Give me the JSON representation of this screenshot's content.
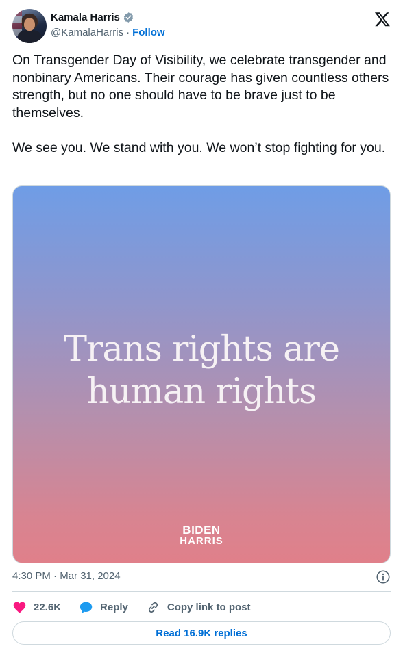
{
  "author": {
    "name": "Kamala Harris",
    "handle": "@KamalaHarris",
    "separator": "·",
    "follow_label": "Follow"
  },
  "tweet": {
    "text": "On Transgender Day of Visibility, we celebrate transgender and nonbinary Americans. Their courage has given countless others strength, but no one should have to be brave just to be themselves.\n\nWe see you. We stand with you. We won’t stop fighting for you.",
    "media": {
      "headline": "Trans rights are\nhuman rights",
      "brand_line1": "BIDEN",
      "brand_line2": "HARRIS"
    },
    "timestamp": "4:30 PM · Mar 31, 2024"
  },
  "actions": {
    "likes": "22.6K",
    "reply_label": "Reply",
    "copy_label": "Copy link to post"
  },
  "replies_button": "Read 16.9K replies",
  "colors": {
    "like": "#f91880",
    "reply": "#1d9bf0",
    "link": "#006fd6",
    "verified": "#829aab",
    "gradient_top": "#6f9de6",
    "gradient_bottom": "#e0808a"
  },
  "icons": {
    "verified": "verified-badge-icon",
    "x": "x-logo-icon",
    "info": "info-icon",
    "like": "heart-icon",
    "reply": "speech-bubble-icon",
    "copy": "link-icon"
  }
}
